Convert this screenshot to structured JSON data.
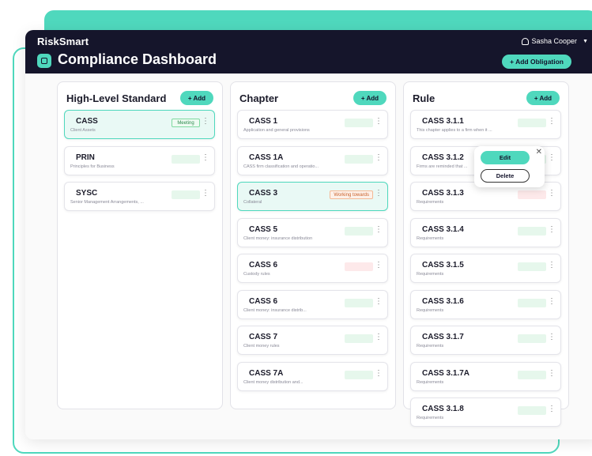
{
  "app": {
    "brand": "RiskSmart",
    "user": "Sasha Cooper"
  },
  "page": {
    "title": "Compliance Dashboard",
    "add_obligation": "+ Add Obligation"
  },
  "columns": [
    {
      "title": "High-Level Standard",
      "add_label": "+ Add",
      "cards": [
        {
          "title": "CASS",
          "subtitle": "Client Assets",
          "status": "Meeting",
          "status_type": "meeting",
          "selected": true
        },
        {
          "title": "PRIN",
          "subtitle": "Principles for Business",
          "status": "",
          "status_type": "green",
          "selected": false
        },
        {
          "title": "SYSC",
          "subtitle": "Senior Management Arrangements, ...",
          "status": "",
          "status_type": "green",
          "selected": false
        }
      ]
    },
    {
      "title": "Chapter",
      "add_label": "+ Add",
      "cards": [
        {
          "title": "CASS 1",
          "subtitle": "Application and general provisions",
          "status": "",
          "status_type": "green",
          "selected": false
        },
        {
          "title": "CASS 1A",
          "subtitle": "CASS firm classification and operatio...",
          "status": "",
          "status_type": "green",
          "selected": false
        },
        {
          "title": "CASS 3",
          "subtitle": "Collateral",
          "status": "Working towards",
          "status_type": "working",
          "selected": true
        },
        {
          "title": "CASS 5",
          "subtitle": "Client money: insurance distribution",
          "status": "",
          "status_type": "green",
          "selected": false
        },
        {
          "title": "CASS 6",
          "subtitle": "Custody rules",
          "status": "",
          "status_type": "pink",
          "selected": false
        },
        {
          "title": "CASS 6",
          "subtitle": "Client money: insurance distrib...",
          "status": "",
          "status_type": "green",
          "selected": false
        },
        {
          "title": "CASS 7",
          "subtitle": "Client money rules",
          "status": "",
          "status_type": "green",
          "selected": false
        },
        {
          "title": "CASS 7A",
          "subtitle": "Client money distribution and...",
          "status": "",
          "status_type": "green",
          "selected": false
        }
      ]
    },
    {
      "title": "Rule",
      "add_label": "+ Add",
      "cards": [
        {
          "title": "CASS 3.1.1",
          "subtitle": "This chapter applies to a firm when it ...",
          "status": "",
          "status_type": "green",
          "selected": false
        },
        {
          "title": "CASS 3.1.2",
          "subtitle": "Firms are reminded that ...",
          "status": "",
          "status_type": "green",
          "selected": false
        },
        {
          "title": "CASS 3.1.3",
          "subtitle": "Requirements",
          "status": "",
          "status_type": "pink",
          "selected": false
        },
        {
          "title": "CASS 3.1.4",
          "subtitle": "Requirements",
          "status": "",
          "status_type": "green",
          "selected": false
        },
        {
          "title": "CASS 3.1.5",
          "subtitle": "Requirements",
          "status": "",
          "status_type": "green",
          "selected": false
        },
        {
          "title": "CASS 3.1.6",
          "subtitle": "Requirements",
          "status": "",
          "status_type": "green",
          "selected": false
        },
        {
          "title": "CASS 3.1.7",
          "subtitle": "Requirements",
          "status": "",
          "status_type": "green",
          "selected": false
        },
        {
          "title": "CASS 3.1.7A",
          "subtitle": "Requirements",
          "status": "",
          "status_type": "green",
          "selected": false
        },
        {
          "title": "CASS 3.1.8",
          "subtitle": "Requirements",
          "status": "",
          "status_type": "green",
          "selected": false
        }
      ]
    }
  ],
  "popup": {
    "edit_label": "Edit",
    "delete_label": "Delete"
  },
  "colors": {
    "accent": "#4fd8bd",
    "header_bg": "#15152b"
  }
}
